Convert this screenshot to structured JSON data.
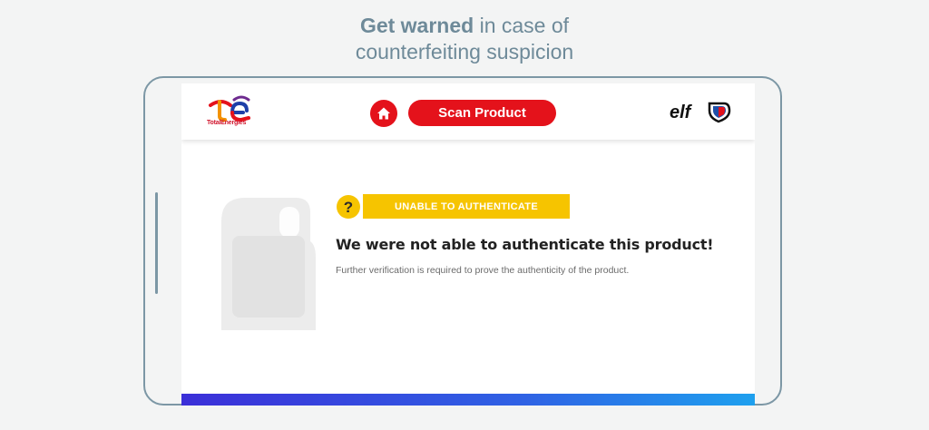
{
  "headline": {
    "bold": "Get warned",
    "rest": " in case of",
    "line2": "counterfeiting suspicion"
  },
  "header": {
    "brand_name": "TotalEnergies",
    "scan_label": "Scan Product",
    "home_icon": "home-icon",
    "elf_logo": "elf"
  },
  "result": {
    "status_icon": "question-icon",
    "status": "UNABLE TO AUTHENTICATE",
    "title": "We were not able to authenticate this product!",
    "description": "Further verification is required to prove the authenticity of the product."
  },
  "colors": {
    "brand_red": "#e4121b",
    "status_yellow": "#f6c400",
    "headline_text": "#6e8a99",
    "gradient_start": "#3b2fd8",
    "gradient_end": "#1ea0ee"
  }
}
